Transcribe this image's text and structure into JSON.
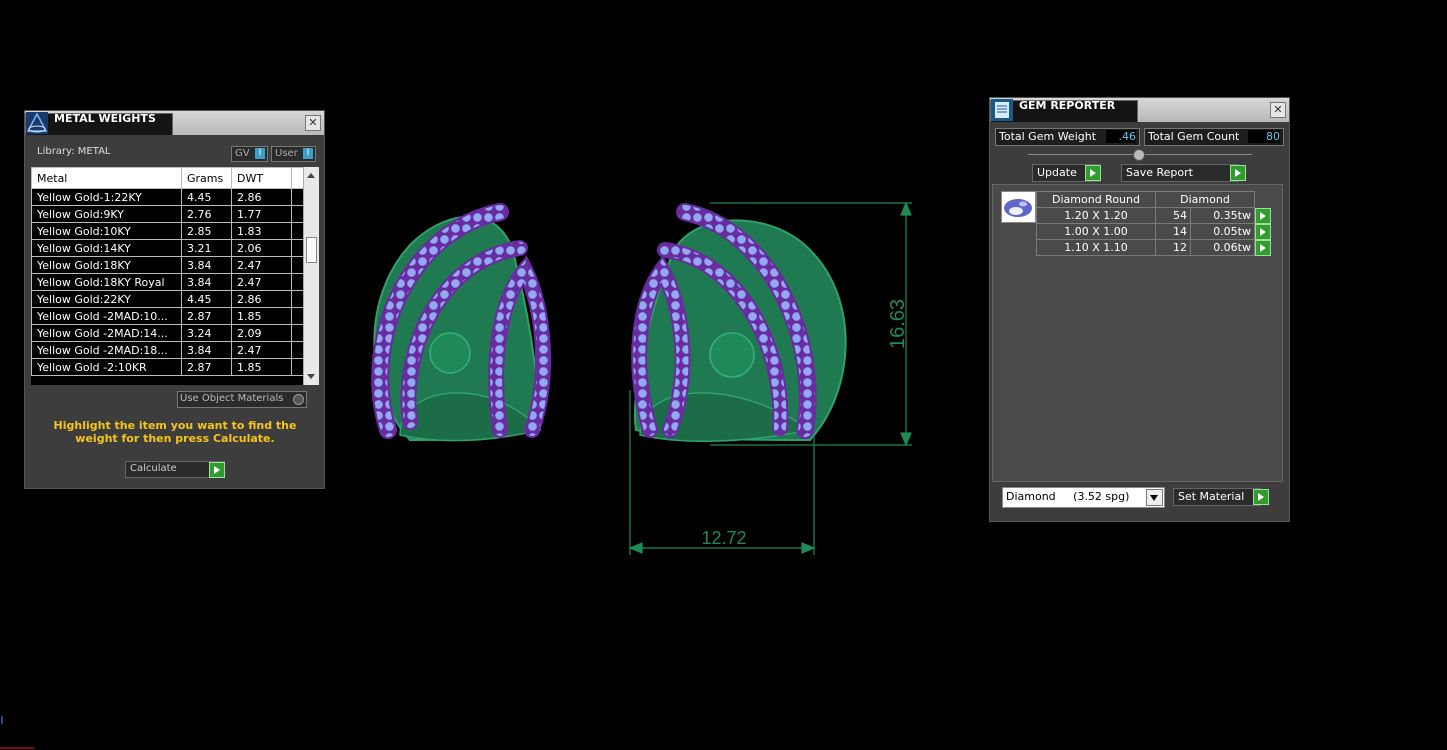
{
  "metal_weights": {
    "title": "METAL WEIGHTS",
    "library_label": "Library: METAL",
    "gv_label": "GV",
    "user_label": "User",
    "toggle_glyph": "I",
    "columns": [
      "Metal",
      "Grams",
      "DWT"
    ],
    "rows": [
      {
        "metal": "Yellow Gold-1:22KY",
        "grams": "4.45",
        "dwt": "2.86"
      },
      {
        "metal": "Yellow Gold:9KY",
        "grams": "2.76",
        "dwt": "1.77"
      },
      {
        "metal": "Yellow Gold:10KY",
        "grams": "2.85",
        "dwt": "1.83"
      },
      {
        "metal": "Yellow Gold:14KY",
        "grams": "3.21",
        "dwt": "2.06"
      },
      {
        "metal": "Yellow Gold:18KY",
        "grams": "3.84",
        "dwt": "2.47"
      },
      {
        "metal": "Yellow Gold:18KY Royal",
        "grams": "3.84",
        "dwt": "2.47"
      },
      {
        "metal": "Yellow Gold:22KY",
        "grams": "4.45",
        "dwt": "2.86"
      },
      {
        "metal": "Yellow Gold -2MAD:10...",
        "grams": "2.87",
        "dwt": "1.85"
      },
      {
        "metal": "Yellow Gold -2MAD:14...",
        "grams": "3.24",
        "dwt": "2.09"
      },
      {
        "metal": "Yellow Gold -2MAD:18...",
        "grams": "3.84",
        "dwt": "2.47"
      },
      {
        "metal": "Yellow Gold -2:10KR",
        "grams": "2.87",
        "dwt": "1.85"
      }
    ],
    "use_object_materials": "Use Object Materials",
    "hint": "Highlight the item you want to find the weight for then press Calculate.",
    "calculate_label": "Calculate",
    "close_glyph": "✕"
  },
  "gem_reporter": {
    "title": "GEM REPORTER",
    "total_weight_label": "Total Gem Weight",
    "total_weight_value": ".46",
    "total_count_label": "Total Gem Count",
    "total_count_value": "80",
    "update_label": "Update",
    "save_report_label": "Save Report",
    "shape_header": "Diamond Round",
    "material_header": "Diamond",
    "rows": [
      {
        "size": "1.20 X 1.20",
        "count": "54",
        "weight": "0.35tw"
      },
      {
        "size": "1.00 X 1.00",
        "count": "14",
        "weight": "0.05tw"
      },
      {
        "size": "1.10 X 1.10",
        "count": "12",
        "weight": "0.06tw"
      }
    ],
    "material_select": "Diamond     (3.52 spg)",
    "set_material_label": "Set Material",
    "close_glyph": "✕"
  },
  "viewport": {
    "dim_height": "16.63",
    "dim_width": "12.72",
    "colors": {
      "metal": "#1f7a52",
      "metal_light": "#2f9a6a",
      "gem_fill": "#8fa3ee",
      "prong": "#7a2fb0",
      "dimension": "#1e8a55"
    }
  }
}
